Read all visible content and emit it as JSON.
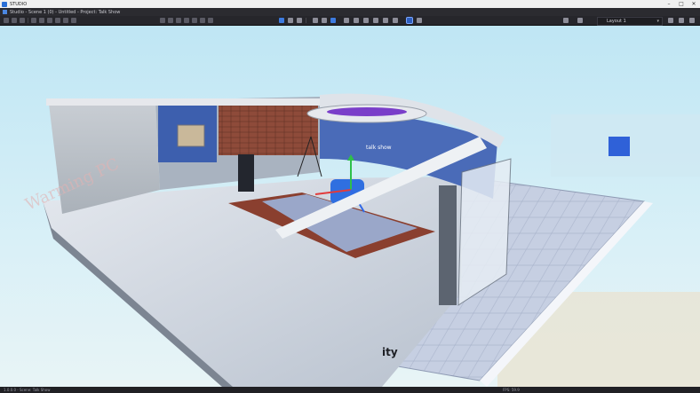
{
  "window": {
    "title": "STUDIO"
  },
  "document": {
    "title": "Studio - Scene 1 (0) - Untitled - Project: Talk Show"
  },
  "toolbar": {
    "layout_label": "Layout 1",
    "layout_options_visible": [
      "Layout 1"
    ]
  },
  "viewport": {
    "watermark_text": "Warming PC",
    "screen_caption": "talk show",
    "floor_brand_text": "ity",
    "gizmo_axes": [
      "x",
      "y",
      "z"
    ]
  },
  "statusbar": {
    "left_text": "1.0.0.0 - Scene: Talk Show",
    "right_text": "FPS: 59.9"
  },
  "colors": {
    "accent": "#3d7be0",
    "gizmo_x": "#e23b3b",
    "gizmo_y": "#2fc04a",
    "gizmo_z": "#3068e6",
    "selected_object": "#2f6fe0"
  }
}
